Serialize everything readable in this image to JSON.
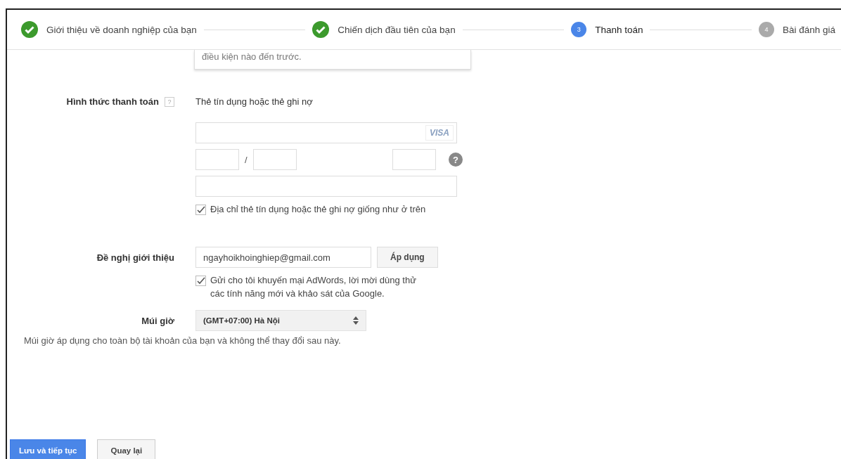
{
  "steps": [
    {
      "label": "Giới thiệu về doanh nghiệp của bạn",
      "completed": true,
      "selected": false
    },
    {
      "label": "Chiến dịch đầu tiên của bạn",
      "completed": true,
      "selected": false
    },
    {
      "label": "Thanh toán",
      "number": "3",
      "completed": false,
      "selected": true
    },
    {
      "label": "Bài đánh giá",
      "number": "4",
      "completed": false,
      "selected": false
    }
  ],
  "previous_card_text": "điều kiện nào đến trước.",
  "payment": {
    "label": "Hình thức thanh toán",
    "help": "?",
    "method": "Thẻ tín dụng hoặc thẻ ghi nợ",
    "card_brand": "VISA",
    "separator": "/",
    "cvc_help": "?",
    "same_address": {
      "label": "Địa chỉ thẻ tín dụng hoặc thẻ ghi nợ giống như ở trên",
      "checked": true
    }
  },
  "referral": {
    "label": "Đề nghị giới thiệu",
    "value": "ngayhoikhoinghiep@gmail.com",
    "apply": "Áp dụng",
    "promo": {
      "label": "Gửi cho tôi khuyến mại AdWords, lời mời dùng thử các tính năng mới và khảo sát của Google.",
      "checked": true
    }
  },
  "timezone": {
    "label": "Múi giờ",
    "value": "(GMT+07:00) Hà Nội",
    "note": "Múi giờ áp dụng cho toàn bộ tài khoản của bạn và không thể thay đổi sau này."
  },
  "buttons": [
    {
      "label": "Lưu và tiếp tục",
      "kind": "primary"
    },
    {
      "label": "Quay lại",
      "kind": "secondary"
    }
  ]
}
